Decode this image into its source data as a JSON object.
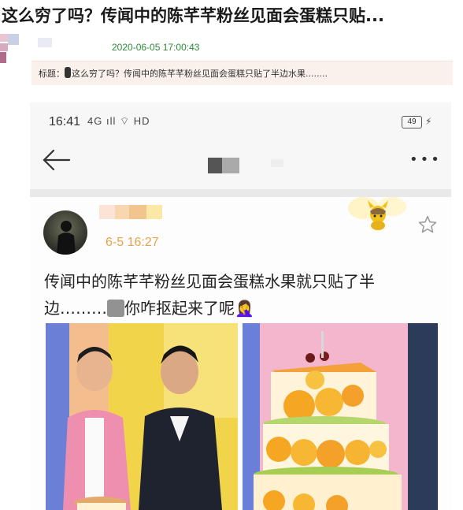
{
  "article": {
    "headline": "这么穷了吗？传闻中的陈芊芊粉丝见面会蛋糕只贴...",
    "timestamp": "2020-06-05 17:00:43",
    "subject_label": "标题：",
    "subject_text": "这么穷了吗？传闻中的陈芊芊粉丝见面会蛋糕只贴了半边水果........"
  },
  "phone_status": {
    "time": "16:41",
    "signal_text": "4G ıll ⌔ HD",
    "battery": "49"
  },
  "post": {
    "time": "6-5 16:27",
    "text_line1": "传闻中的陈芊芊粉丝见面会蛋糕水果就只贴了半",
    "text_line2_start": "边………",
    "text_line2_end": "你咋抠起来了呢",
    "emoji": "🤦‍♀️"
  },
  "icons": {
    "back": "back-arrow-icon",
    "more": "more-dots-icon",
    "star": "star-icon",
    "sticker": "pikachu-sticker-icon"
  },
  "colors": {
    "date_green": "#2e8b3a",
    "post_time_orange": "#e8a24a",
    "post_bar_bg": "#fbf1ec"
  }
}
